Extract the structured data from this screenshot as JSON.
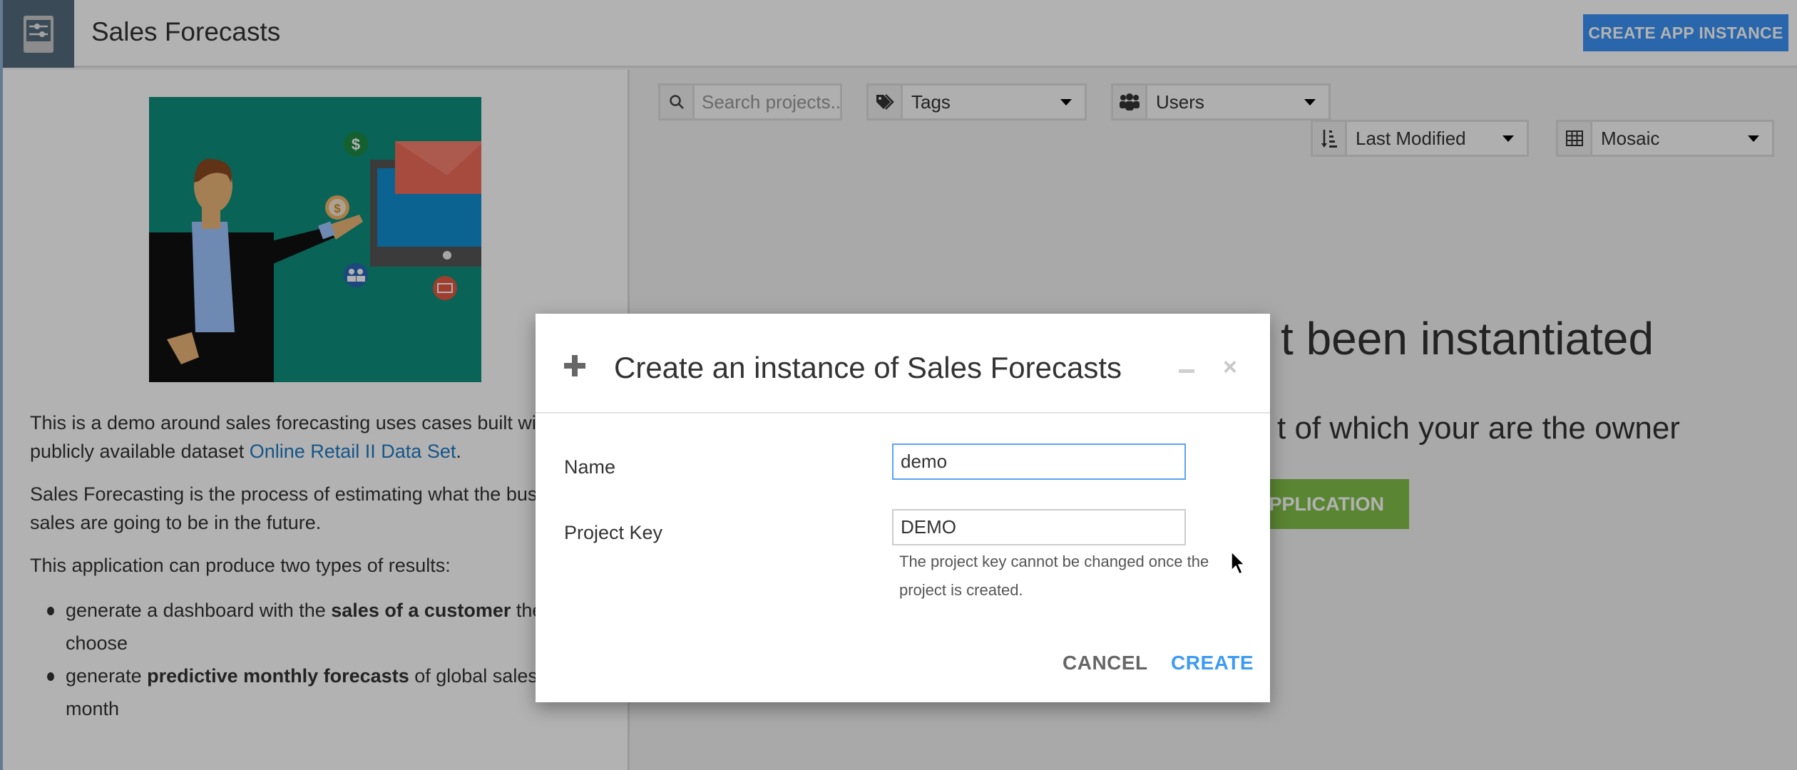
{
  "header": {
    "app_icon": "sliders-panel-icon",
    "title": "Sales Forecasts",
    "create_app_instance_label": "CREATE APP INSTANCE"
  },
  "left_panel": {
    "hero_image": "businessman-presenting-sales-illustration",
    "paragraph_1_text": "This is a demo around sales forecasting uses cases built with t",
    "paragraph_1_cont": "publicly available dataset ",
    "paragraph_1_link": "Online Retail II Data Set",
    "paragraph_1_end": ".",
    "paragraph_2_line1": "Sales Forecasting is the process of estimating what the busine",
    "paragraph_2_line2": "sales are going to be in the future.",
    "paragraph_3": "This application can produce two types of results:",
    "bullets": [
      {
        "pre": "generate a dashboard with the ",
        "bold": "sales of a customer",
        "post": " the u",
        "line2": "choose"
      },
      {
        "pre": "generate ",
        "bold": "predictive monthly forecasts",
        "post": " of global sales pe",
        "line2": "month"
      }
    ]
  },
  "toolbar": {
    "search_placeholder": "Search projects...",
    "search_icon": "search-icon",
    "tags_label": "Tags",
    "tags_icon": "tags-icon",
    "users_label": "Users",
    "users_icon": "users-icon",
    "sort_label": "Last Modified",
    "sort_icon": "sort-descending-icon",
    "view_label": "Mosaic",
    "view_icon": "grid-icon"
  },
  "empty_state": {
    "title_visible": "t been instantiated",
    "subtitle_visible": "t of which your are the owner",
    "button_visible": "PPLICATION"
  },
  "modal": {
    "title": "Create an instance of Sales Forecasts",
    "name_label": "Name",
    "name_value": "demo",
    "project_key_label": "Project Key",
    "project_key_value": "DEMO",
    "help_text": "The project key cannot be changed once the project is created.",
    "cancel_label": "CANCEL",
    "create_label": "CREATE",
    "close_glyph": "×"
  },
  "colors": {
    "primary_blue": "#3b92f5",
    "create_link_blue": "#3d9bf4",
    "green_action": "#81bf48",
    "logo_bg": "#546b7c",
    "hero_bg": "#0d8e7c"
  }
}
